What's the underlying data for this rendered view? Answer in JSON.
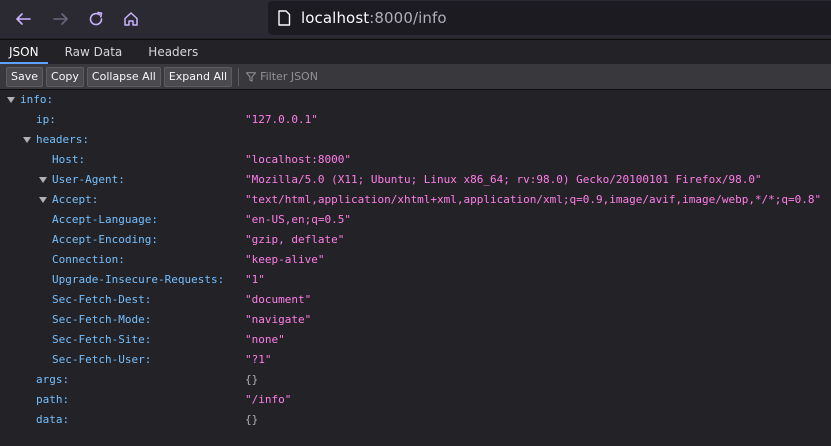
{
  "url": {
    "host": "localhost",
    "rest": ":8000/info"
  },
  "tabs": [
    "JSON",
    "Raw Data",
    "Headers"
  ],
  "toolbar": {
    "save": "Save",
    "copy": "Copy",
    "collapse_all": "Collapse All",
    "expand_all": "Expand All",
    "filter_placeholder": "Filter JSON"
  },
  "tree": {
    "info_key": "info:",
    "ip_key": "ip:",
    "ip_val": "\"127.0.0.1\"",
    "headers_key": "headers:",
    "host_key": "Host:",
    "host_val": "\"localhost:8000\"",
    "ua_key": "User-Agent:",
    "ua_val": "\"Mozilla/5.0 (X11; Ubuntu; Linux x86_64; rv:98.0) Gecko/20100101 Firefox/98.0\"",
    "accept_key": "Accept:",
    "accept_val": "\"text/html,application/xhtml+xml,application/xml;q=0.9,image/avif,image/webp,*/*;q=0.8\"",
    "accept_lang_key": "Accept-Language:",
    "accept_lang_val": "\"en-US,en;q=0.5\"",
    "accept_enc_key": "Accept-Encoding:",
    "accept_enc_val": "\"gzip, deflate\"",
    "connection_key": "Connection:",
    "connection_val": "\"keep-alive\"",
    "upgrade_key": "Upgrade-Insecure-Requests:",
    "upgrade_val": "\"1\"",
    "dest_key": "Sec-Fetch-Dest:",
    "dest_val": "\"document\"",
    "mode_key": "Sec-Fetch-Mode:",
    "mode_val": "\"navigate\"",
    "site_key": "Sec-Fetch-Site:",
    "site_val": "\"none\"",
    "user_key": "Sec-Fetch-User:",
    "user_val": "\"?1\"",
    "args_key": "args:",
    "args_val": "{}",
    "path_key": "path:",
    "path_val": "\"/info\"",
    "data_key": "data:",
    "data_val": "{}"
  }
}
